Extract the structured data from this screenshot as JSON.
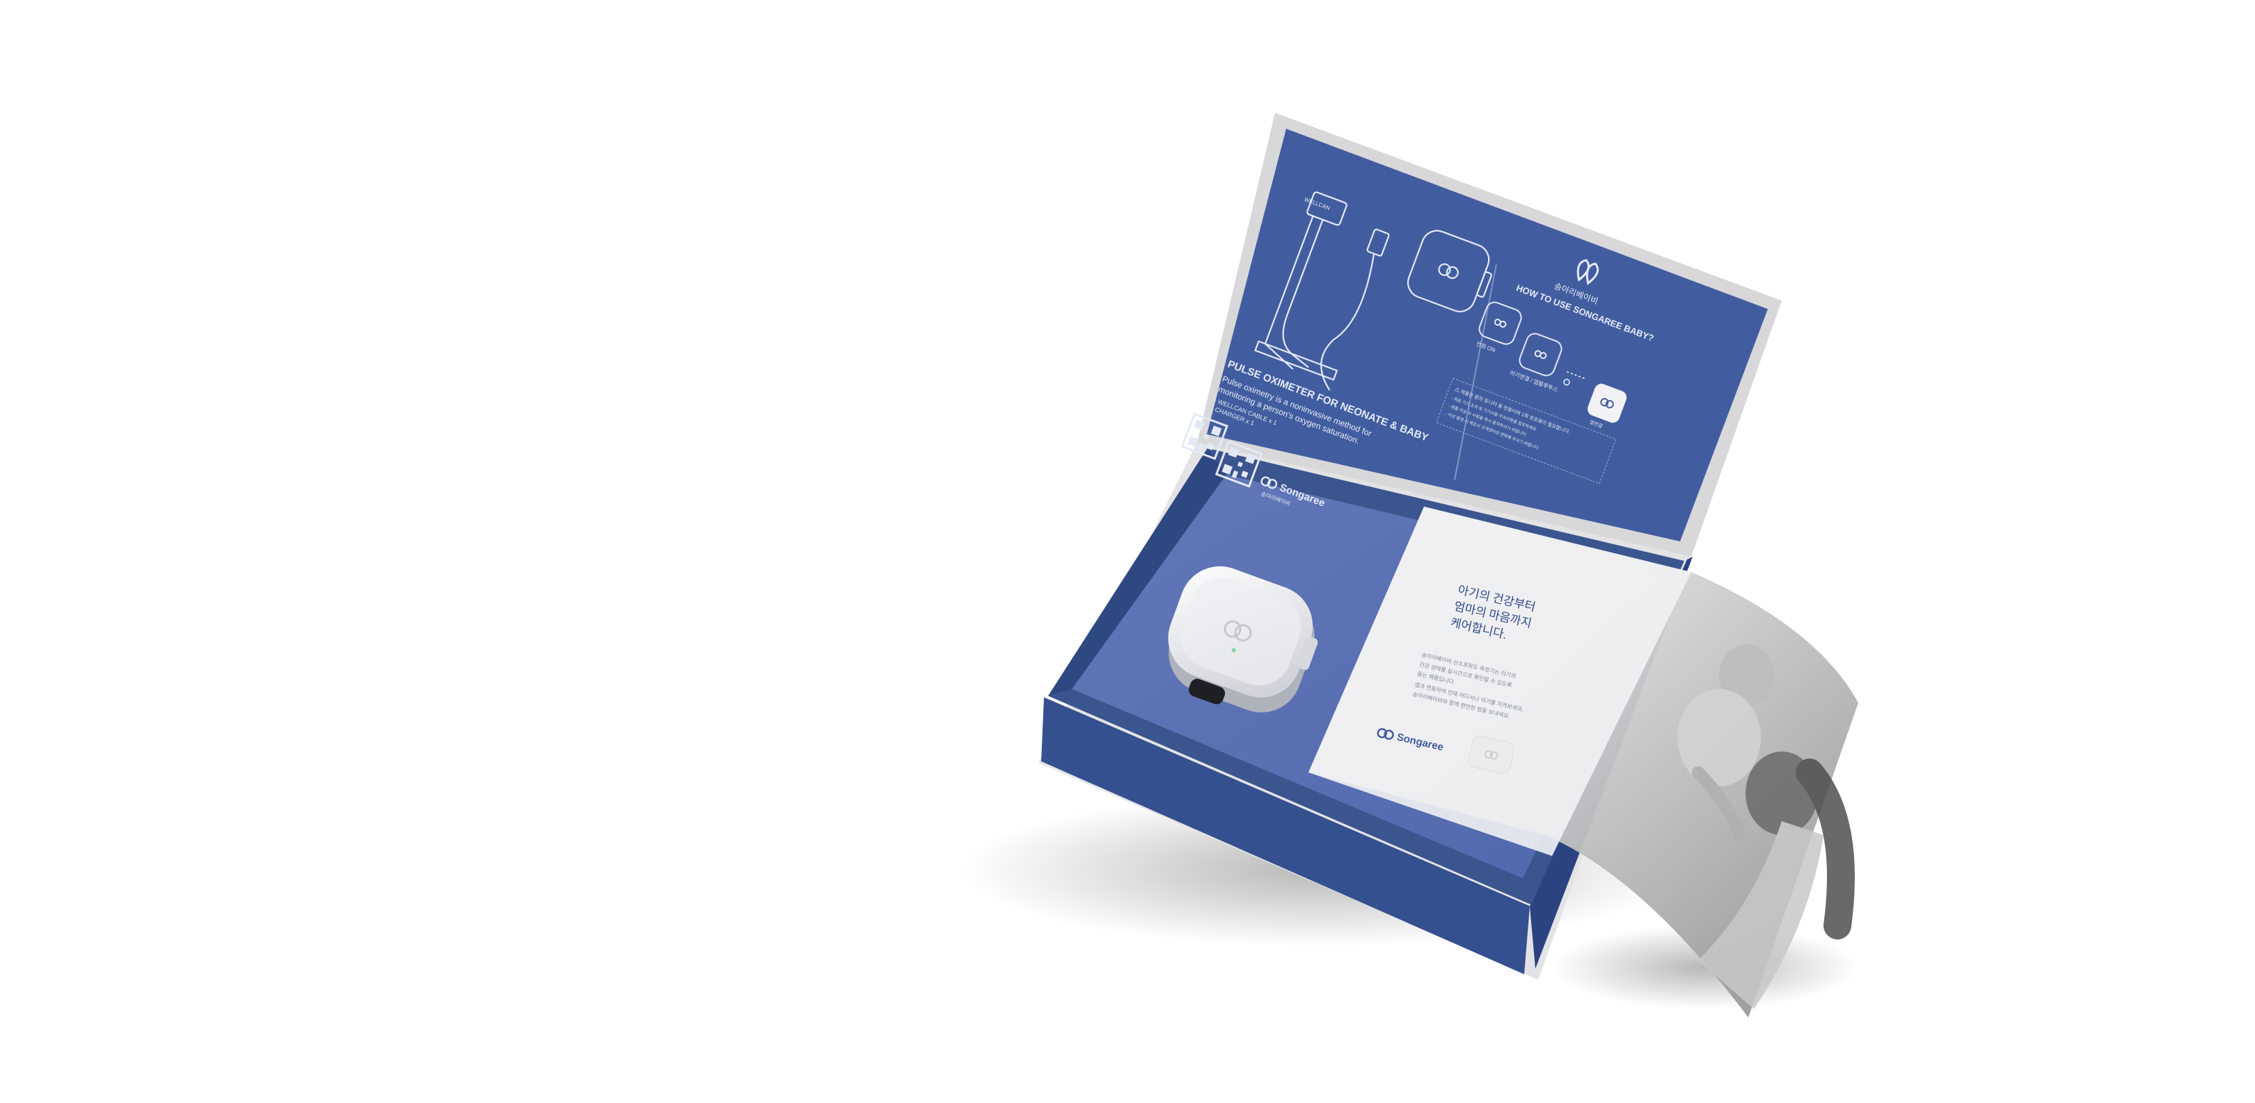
{
  "colors": {
    "box_blue": "#3f5a9c",
    "lid_blue": "#425d9f",
    "tray_blue": "#5b72b5",
    "line_white": "#e4e9f7",
    "card_white": "#f2f2f4"
  },
  "lid": {
    "cable_label": "WELLCAN",
    "product_title": "PULSE OXIMETER FOR NEONATE & BABY",
    "product_desc_1": "Pulse oximetry is a noninvasive method for",
    "product_desc_2": "monitoring a person's oxygen saturation.",
    "contents_1": "- WELLCAN CABLE x 1",
    "contents_2": "- CHARGER x 1",
    "brand_logo_text": "Songaree",
    "brand_sub": "송아리베이비",
    "howto_brand": "송아리베이비",
    "howto_title": "HOW TO USE SONGAREE BABY?",
    "step1_label": "전원 ON",
    "step2_label": "아기연결 / 앱블루투스",
    "step3_label": "앱연결",
    "warning_line_1": "⚠ 제품은 환자 모니터 용 전용이며 1회 보호용이 필요합니다.",
    "warning_line_2": "- 의료 기기 조작 및 기기사용 주의사항을 참조하세요.",
    "warning_line_3": "- 제품 이상 시 사용을 즉시 중지하시기 바랍니다.",
    "warning_line_4": "- 이상 발생 시 제조사 고객센터로 연락해 주시기 바랍니다."
  },
  "card": {
    "headline_1": "아기의 건강부터",
    "headline_2": "엄마의 마음까지",
    "headline_3": "케어합니다.",
    "body_1": "송아리베이비 산소포화도 측정기는 아기의",
    "body_2": "건강 상태를 실시간으로 확인할 수 있도록",
    "body_3": "돕는 제품입니다.",
    "body_4": "앱과 연동하여 언제 어디서나 아기를 지켜보세요.",
    "body_5": "송아리베이비와 함께 편안한 밤을 보내세요.",
    "brand_logo_text": "Songaree"
  }
}
